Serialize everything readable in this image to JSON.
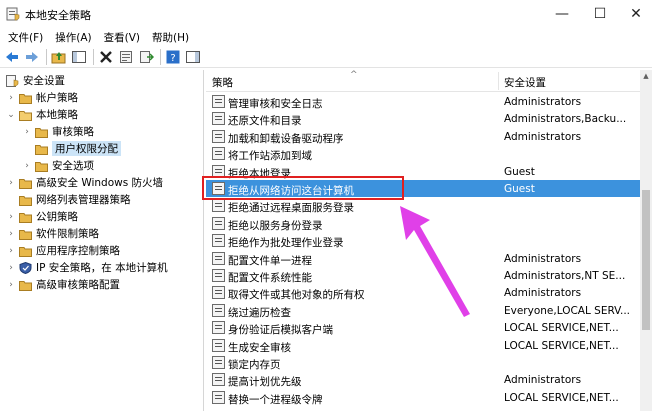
{
  "window": {
    "title": "本地安全策略",
    "minimize": "—",
    "maximize": "☐",
    "close": "✕"
  },
  "menu": [
    "文件(F)",
    "操作(A)",
    "查看(V)",
    "帮助(H)"
  ],
  "tree": [
    {
      "label": "安全设置",
      "chevron": ""
    },
    {
      "label": "帐户策略",
      "chevron": "›"
    },
    {
      "label": "本地策略",
      "chevron": "⌄"
    },
    {
      "label": "审核策略",
      "chevron": "›"
    },
    {
      "label": "用户权限分配",
      "chevron": ""
    },
    {
      "label": "安全选项",
      "chevron": "›"
    },
    {
      "label": "高级安全 Windows 防火墙",
      "chevron": "›"
    },
    {
      "label": "网络列表管理器策略",
      "chevron": ""
    },
    {
      "label": "公钥策略",
      "chevron": "›"
    },
    {
      "label": "软件限制策略",
      "chevron": "›"
    },
    {
      "label": "应用程序控制策略",
      "chevron": "›"
    },
    {
      "label": "IP 安全策略，在 本地计算机",
      "chevron": "›"
    },
    {
      "label": "高级审核策略配置",
      "chevron": "›"
    }
  ],
  "list": {
    "header_policy": "策略",
    "header_setting": "安全设置",
    "sort_arrow": "^",
    "rows": [
      {
        "name": "管理审核和安全日志",
        "value": "Administrators"
      },
      {
        "name": "还原文件和目录",
        "value": "Administrators,Backu..."
      },
      {
        "name": "加载和卸载设备驱动程序",
        "value": "Administrators"
      },
      {
        "name": "将工作站添加到域",
        "value": ""
      },
      {
        "name": "拒绝本地登录",
        "value": "Guest"
      },
      {
        "name": "拒绝从网络访问这台计算机",
        "value": "Guest"
      },
      {
        "name": "拒绝通过远程桌面服务登录",
        "value": ""
      },
      {
        "name": "拒绝以服务身份登录",
        "value": ""
      },
      {
        "name": "拒绝作为批处理作业登录",
        "value": ""
      },
      {
        "name": "配置文件单一进程",
        "value": "Administrators"
      },
      {
        "name": "配置文件系统性能",
        "value": "Administrators,NT SE..."
      },
      {
        "name": "取得文件或其他对象的所有权",
        "value": "Administrators"
      },
      {
        "name": "绕过遍历检查",
        "value": "Everyone,LOCAL SERV..."
      },
      {
        "name": "身份验证后模拟客户端",
        "value": "LOCAL SERVICE,NET..."
      },
      {
        "name": "生成安全审核",
        "value": "LOCAL SERVICE,NET..."
      },
      {
        "name": "锁定内存页",
        "value": ""
      },
      {
        "name": "提高计划优先级",
        "value": "Administrators"
      },
      {
        "name": "替换一个进程级令牌",
        "value": "LOCAL SERVICE,NET..."
      }
    ]
  },
  "scroll_up": "▲",
  "colors": {
    "selection": "#3c92dd",
    "highlight_box": "#e02020",
    "arrow": "#e040e8",
    "folder": "#e8b84a"
  }
}
